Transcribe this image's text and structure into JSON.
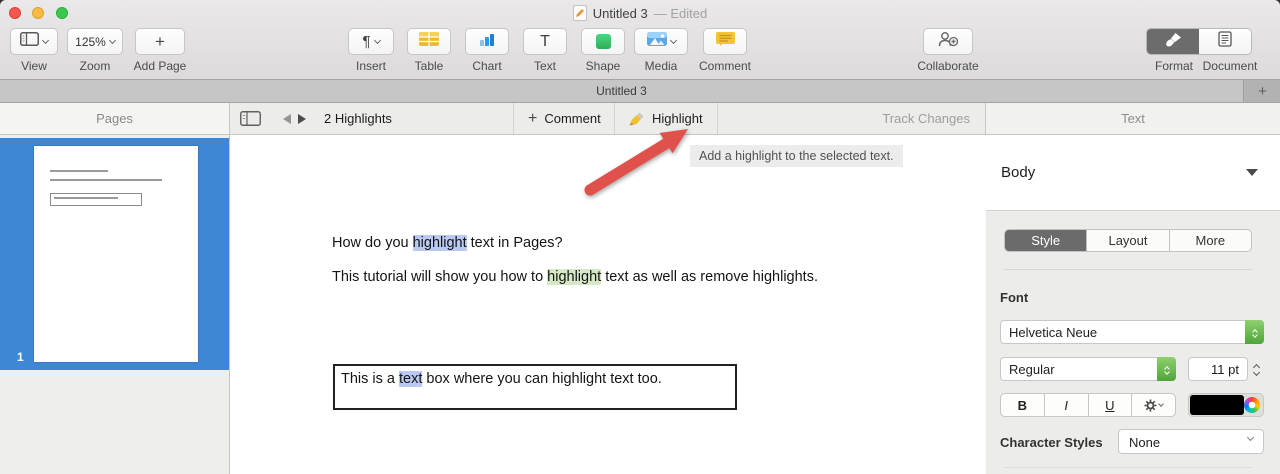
{
  "titlebar": {
    "title": "Untitled 3",
    "edited_suffix": "— Edited"
  },
  "tabbar": {
    "tab_title": "Untitled 3"
  },
  "toolbar": {
    "view_label": "View",
    "zoom_value": "125%",
    "zoom_label": "Zoom",
    "add_page_label": "Add Page",
    "insert_label": "Insert",
    "table_label": "Table",
    "chart_label": "Chart",
    "text_label": "Text",
    "shape_label": "Shape",
    "media_label": "Media",
    "comment_label": "Comment",
    "collaborate_label": "Collaborate",
    "format_label": "Format",
    "document_label": "Document"
  },
  "contextbar": {
    "pages_header": "Pages",
    "highlights_status": "2 Highlights",
    "comment_button": "Comment",
    "highlight_button": "Highlight",
    "track_changes": "Track Changes",
    "inspector_header": "Text"
  },
  "tooltip": {
    "text": "Add a highlight to the selected text."
  },
  "sidebar": {
    "page_number": "1"
  },
  "document": {
    "heading": {
      "pre": "How do you ",
      "highlighted": "highlight",
      "post": " text in Pages?"
    },
    "body_line": {
      "pre": "This tutorial will show you how to ",
      "highlighted": "highlight",
      "post": " text as well as remove highlights."
    },
    "text_box": {
      "pre": "This is a ",
      "highlighted": "text",
      "post": " box where you can highlight text too."
    }
  },
  "inspector": {
    "paragraph_style": "Body",
    "tabs": {
      "style": "Style",
      "layout": "Layout",
      "more": "More"
    },
    "font_section_label": "Font",
    "font_family": "Helvetica Neue",
    "font_weight": "Regular",
    "font_size": "11 pt",
    "bold": "B",
    "italic": "I",
    "underline": "U",
    "character_styles_label": "Character Styles",
    "character_styles_value": "None"
  },
  "icons": {
    "plus": "+",
    "pilcrow": "¶",
    "text_tool": "T"
  },
  "colors": {
    "page_selection_blue": "#3f87d4",
    "highlight_blue": "#b9c9f1",
    "highlight_green": "#d6e8c6",
    "annotation_arrow_red": "#e0514b",
    "stepper_green": "#5fae47",
    "format_selected_gray": "#6c6c6c"
  }
}
